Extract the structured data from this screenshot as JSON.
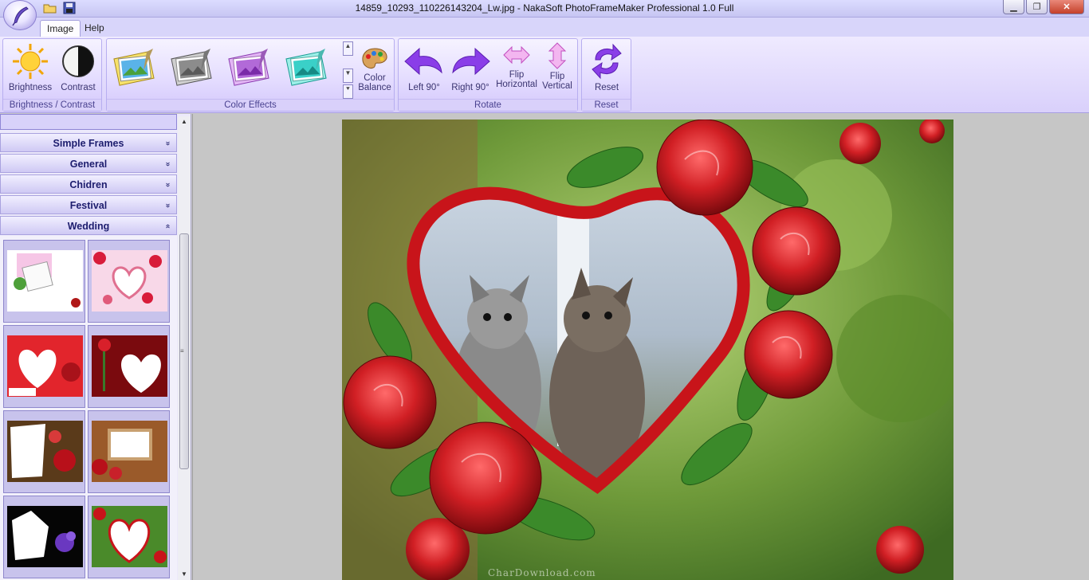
{
  "window": {
    "title": "14859_10293_110226143204_Lw.jpg - NakaSoft PhotoFrameMaker Professional 1.0 Full",
    "minimize": "▁",
    "maximize": "❐",
    "close": "✕"
  },
  "tabs": [
    {
      "label": "Image",
      "active": true
    },
    {
      "label": "Help",
      "active": false
    }
  ],
  "ribbon": {
    "groups": {
      "brightness_contrast": "Brightness / Contrast",
      "color_effects": "Color Effects",
      "rotate": "Rotate",
      "reset": "Reset"
    },
    "buttons": {
      "brightness": "Brightness",
      "contrast": "Contrast",
      "color_balance_1": "Color",
      "color_balance_2": "Balance",
      "left90": "Left 90°",
      "right90": "Right 90°",
      "flip_h_1": "Flip",
      "flip_h_2": "Horizontal",
      "flip_v_1": "Flip",
      "flip_v_2": "Vertical",
      "reset": "Reset"
    },
    "effects": [
      "original",
      "grayscale",
      "purple",
      "cyan"
    ]
  },
  "sidebar": {
    "categories": [
      {
        "label": "Simple Frames",
        "expanded": false
      },
      {
        "label": "General",
        "expanded": false
      },
      {
        "label": "Chidren",
        "expanded": false
      },
      {
        "label": "Festival",
        "expanded": false
      },
      {
        "label": "Wedding",
        "expanded": true
      }
    ],
    "expand_glyph": "»",
    "collapse_glyph": "«"
  },
  "colors": {
    "ribbon_accent": "#8f6fe0",
    "frame_red": "#c8141a",
    "rose_red": "#d11f24",
    "leaf_green": "#3b8a2a"
  },
  "watermark": "CharDownload.com"
}
